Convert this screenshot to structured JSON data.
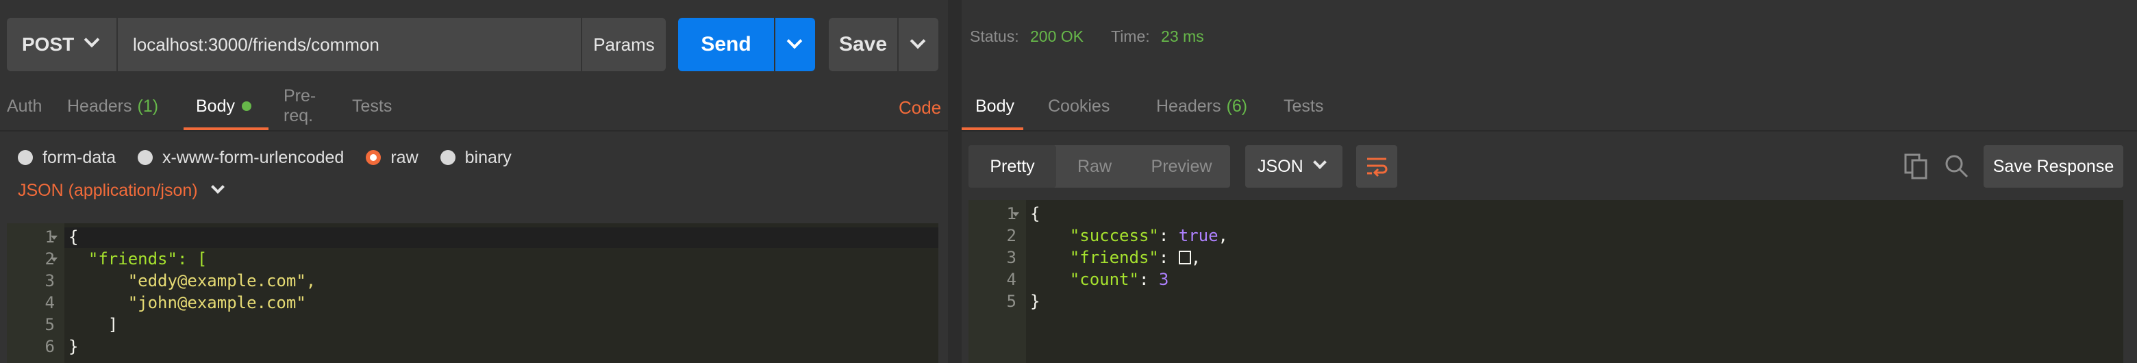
{
  "request": {
    "method": "POST",
    "url": "localhost:3000/friends/common",
    "params_label": "Params",
    "send_label": "Send",
    "save_label": "Save"
  },
  "request_tabs": [
    {
      "label": "Auth"
    },
    {
      "label": "Headers",
      "count": "(1)"
    },
    {
      "label": "Body"
    },
    {
      "label": "Pre-req."
    },
    {
      "label": "Tests"
    }
  ],
  "code_link": "Code",
  "body_modes": [
    "form-data",
    "x-www-form-urlencoded",
    "raw",
    "binary"
  ],
  "selected_body_mode": "raw",
  "content_type": "JSON (application/json)",
  "request_body": {
    "line_numbers": [
      "1",
      "2",
      "3",
      "4",
      "5",
      "6"
    ],
    "lines": [
      "{",
      "  \"friends\": [",
      "      \"eddy@example.com\",",
      "      \"john@example.com\"",
      "    ]",
      "}"
    ]
  },
  "status": {
    "status_label": "Status:",
    "status_value": "200 OK",
    "time_label": "Time:",
    "time_value": "23 ms"
  },
  "response_tabs": [
    {
      "label": "Body"
    },
    {
      "label": "Cookies"
    },
    {
      "label": "Headers",
      "count": "(6)"
    },
    {
      "label": "Tests"
    }
  ],
  "view_modes": [
    "Pretty",
    "Raw",
    "Preview"
  ],
  "format": "JSON",
  "save_response_label": "Save Response",
  "response_body": {
    "line_numbers": [
      "1",
      "2",
      "3",
      "4",
      "5"
    ],
    "success_key": "\"success\"",
    "success_value": "true",
    "friends_key": "\"friends\"",
    "count_key": "\"count\"",
    "count_value": "3"
  },
  "colors": {
    "accent": "#f26b3a",
    "send_blue": "#097bed",
    "ok_green": "#67b84a",
    "editor_bg": "#272822"
  },
  "icons": [
    "chevron-down-icon",
    "wrap-lines-icon",
    "copy-icon",
    "search-icon"
  ]
}
